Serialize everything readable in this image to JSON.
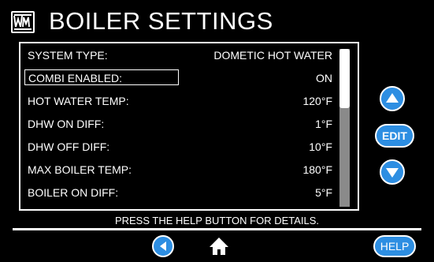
{
  "header": {
    "title": "BOILER SETTINGS",
    "logo_icon": "wm-logo-icon"
  },
  "settings": {
    "rows": [
      {
        "label": "SYSTEM TYPE:",
        "value": "DOMETIC HOT WATER"
      },
      {
        "label": "COMBI ENABLED:",
        "value": "ON",
        "selected": true
      },
      {
        "label": "HOT WATER TEMP:",
        "value": "120°F"
      },
      {
        "label": "DHW ON DIFF:",
        "value": "1°F"
      },
      {
        "label": "DHW OFF DIFF:",
        "value": "10°F"
      },
      {
        "label": "MAX BOILER TEMP:",
        "value": "180°F"
      },
      {
        "label": "BOILER ON DIFF:",
        "value": "5°F"
      }
    ]
  },
  "side_controls": {
    "up_icon": "up-arrow-icon",
    "edit_label": "EDIT",
    "down_icon": "down-arrow-icon"
  },
  "footer": {
    "help_text": "PRESS THE HELP BUTTON FOR DETAILS.",
    "back_icon": "back-arrow-icon",
    "home_icon": "home-icon",
    "help_label": "HELP"
  },
  "colors": {
    "accent": "#2d8ee2",
    "background": "#000000",
    "text": "#ffffff",
    "scroll_track": "#8a8a8a"
  }
}
